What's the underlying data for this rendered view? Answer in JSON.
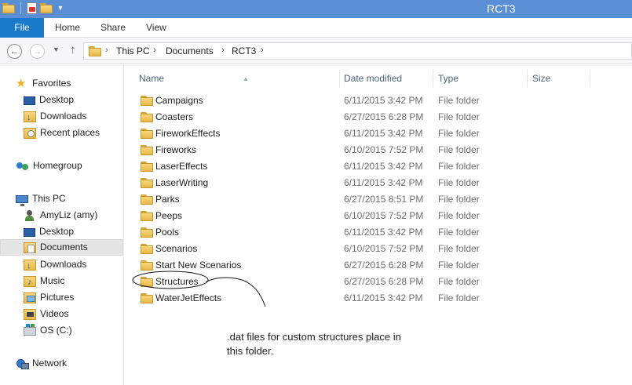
{
  "window": {
    "title": "RCT3"
  },
  "ribbon": {
    "file_tab": "File",
    "tabs": [
      "Home",
      "Share",
      "View"
    ]
  },
  "address": {
    "crumbs": [
      "This PC",
      "Documents",
      "RCT3"
    ]
  },
  "navigation": {
    "favorites": {
      "label": "Favorites",
      "items": [
        "Desktop",
        "Downloads",
        "Recent places"
      ]
    },
    "homegroup": "Homegroup",
    "this_pc": {
      "label": "This PC",
      "items": [
        "AmyLiz (amy)",
        "Desktop",
        "Documents",
        "Downloads",
        "Music",
        "Pictures",
        "Videos",
        "OS (C:)"
      ],
      "selected": "Documents"
    },
    "network": "Network"
  },
  "columns": {
    "name": "Name",
    "date": "Date modified",
    "type": "Type",
    "size": "Size"
  },
  "files": [
    {
      "name": "Campaigns",
      "date": "6/11/2015 3:42 PM",
      "type": "File folder"
    },
    {
      "name": "Coasters",
      "date": "6/27/2015 6:28 PM",
      "type": "File folder"
    },
    {
      "name": "FireworkEffects",
      "date": "6/11/2015 3:42 PM",
      "type": "File folder"
    },
    {
      "name": "Fireworks",
      "date": "6/10/2015 7:52 PM",
      "type": "File folder"
    },
    {
      "name": "LaserEffects",
      "date": "6/11/2015 3:42 PM",
      "type": "File folder"
    },
    {
      "name": "LaserWriting",
      "date": "6/11/2015 3:42 PM",
      "type": "File folder"
    },
    {
      "name": "Parks",
      "date": "6/27/2015 8:51 PM",
      "type": "File folder"
    },
    {
      "name": "Peeps",
      "date": "6/10/2015 7:52 PM",
      "type": "File folder"
    },
    {
      "name": "Pools",
      "date": "6/11/2015 3:42 PM",
      "type": "File folder"
    },
    {
      "name": "Scenarios",
      "date": "6/10/2015 7:52 PM",
      "type": "File folder"
    },
    {
      "name": "Start New Scenarios",
      "date": "6/27/2015 6:28 PM",
      "type": "File folder"
    },
    {
      "name": "Structures",
      "date": "6/27/2015 6:28 PM",
      "type": "File folder"
    },
    {
      "name": "WaterJetEffects",
      "date": "6/11/2015 3:42 PM",
      "type": "File folder"
    }
  ],
  "annotation": {
    "line1": ".dat files for custom structures place in",
    "line2": "this folder."
  },
  "colors": {
    "titlebar": "#5a8fd5",
    "file_tab": "#1979ca",
    "selection": "#e5e5e5"
  }
}
